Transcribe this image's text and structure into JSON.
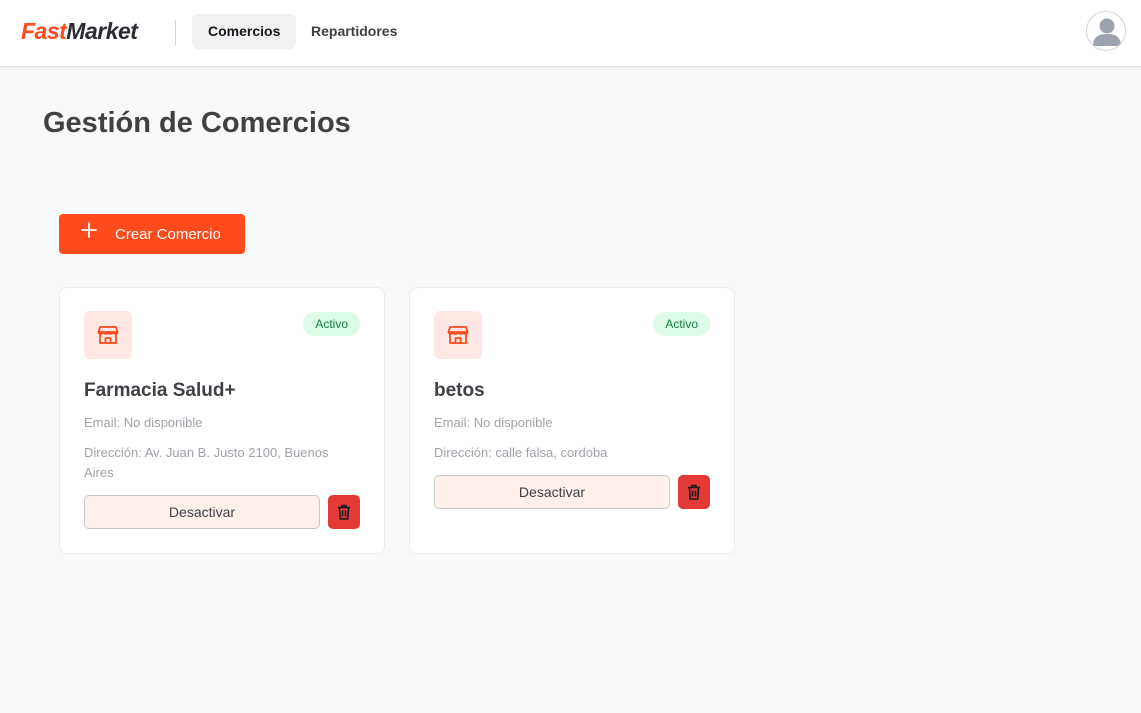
{
  "header": {
    "logo_part1": "Fast",
    "logo_part2": "Market",
    "nav": [
      {
        "label": "Comercios",
        "active": true
      },
      {
        "label": "Repartidores",
        "active": false
      }
    ],
    "avatar_icon": "user-avatar-icon"
  },
  "page": {
    "title": "Gestión de Comercios",
    "create_button": "Crear Comercio"
  },
  "colors": {
    "brand": "#ff4a1c",
    "danger": "#e53935",
    "success_bg": "#dcfce7",
    "success_text": "#15803d"
  },
  "stores": [
    {
      "name": "Farmacia Salud+",
      "status": "Activo",
      "email": "Email: No disponible",
      "address": "Dirección: Av. Juan B. Justo 2100, Buenos Aires",
      "action": "Desactivar"
    },
    {
      "name": "betos",
      "status": "Activo",
      "email": "Email: No disponible",
      "address": "Dirección: calle falsa, cordoba",
      "action": "Desactivar"
    }
  ]
}
